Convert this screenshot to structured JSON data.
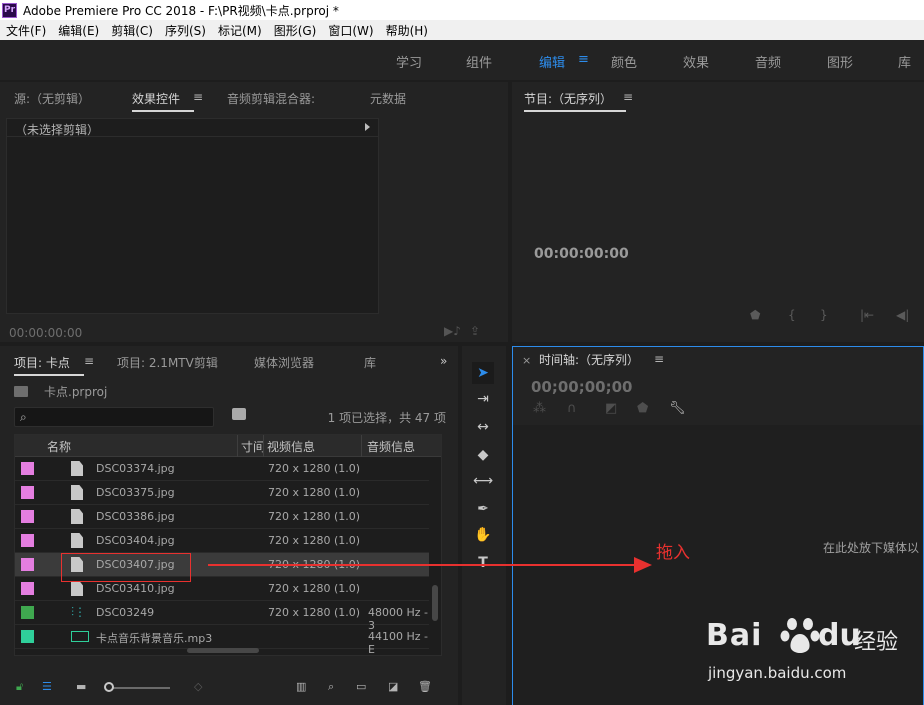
{
  "window": {
    "app_icon": "Pr",
    "title": "Adobe Premiere Pro CC 2018 - F:\\PR视频\\卡点.prproj *"
  },
  "menu": [
    "文件(F)",
    "编辑(E)",
    "剪辑(C)",
    "序列(S)",
    "标记(M)",
    "图形(G)",
    "窗口(W)",
    "帮助(H)"
  ],
  "workspaces": {
    "tabs": [
      "学习",
      "组件",
      "编辑",
      "颜色",
      "效果",
      "音频",
      "图形",
      "库"
    ],
    "active": "编辑",
    "accent": "#2d8ceb"
  },
  "source_panel": {
    "tabs": [
      "源:（无剪辑）",
      "效果控件",
      "音频剪辑混合器:",
      "元数据"
    ],
    "active_tab": "效果控件",
    "no_clip_label": "（未选择剪辑）",
    "timecode": "00:00:00:00"
  },
  "program_panel": {
    "title": "节目:（无序列）",
    "timecode": "00:00:00:00"
  },
  "project_panel": {
    "tabs": [
      "项目: 卡点",
      "项目: 2.1MTV剪辑",
      "媒体浏览器",
      "库"
    ],
    "project_file": "卡点.prproj",
    "search_placeholder": "",
    "selection_info": "1 项已选择，共 47 项",
    "columns": [
      "名称",
      "寸间",
      "视频信息",
      "音频信息"
    ],
    "rows": [
      {
        "name": "DSC03374.jpg",
        "video": "720 x 1280 (1.0)",
        "audio": "",
        "color": "#e47ee0",
        "kind": "image"
      },
      {
        "name": "DSC03375.jpg",
        "video": "720 x 1280 (1.0)",
        "audio": "",
        "color": "#e47ee0",
        "kind": "image"
      },
      {
        "name": "DSC03386.jpg",
        "video": "720 x 1280 (1.0)",
        "audio": "",
        "color": "#e47ee0",
        "kind": "image"
      },
      {
        "name": "DSC03404.jpg",
        "video": "720 x 1280 (1.0)",
        "audio": "",
        "color": "#e47ee0",
        "kind": "image"
      },
      {
        "name": "DSC03407.jpg",
        "video": "720 x 1280 (1.0)",
        "audio": "",
        "color": "#e47ee0",
        "kind": "image",
        "selected": true
      },
      {
        "name": "DSC03410.jpg",
        "video": "720 x 1280 (1.0)",
        "audio": "",
        "color": "#e47ee0",
        "kind": "image"
      },
      {
        "name": "DSC03249",
        "video": "720 x 1280 (1.0)",
        "audio": "48000 Hz - 3",
        "color": "#3fa84f",
        "kind": "audio"
      },
      {
        "name": "卡点音乐背景音乐.mp3",
        "video": "",
        "audio": "44100 Hz - E",
        "color": "#2fcf9a",
        "kind": "av"
      }
    ]
  },
  "timeline_panel": {
    "title": "时间轴:（无序列）",
    "timecode": "00;00;00;00",
    "drop_hint": "在此处放下媒体以"
  },
  "annotation": {
    "label": "拖入",
    "color": "#e8312f"
  },
  "watermark": {
    "brand_a": "Bai",
    "brand_b": "du",
    "brand_cn": "经验",
    "url": "jingyan.baidu.com"
  }
}
